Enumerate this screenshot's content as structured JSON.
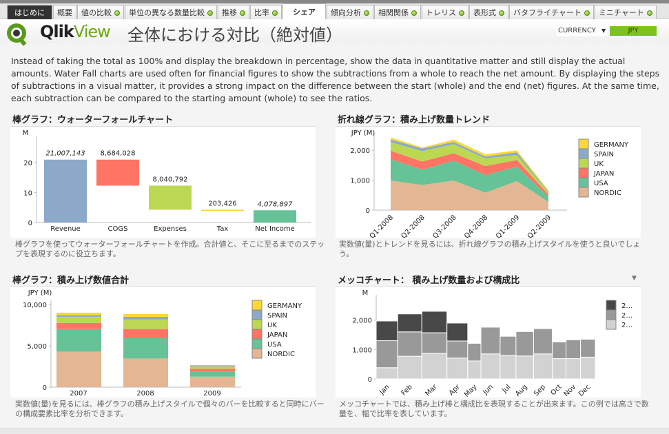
{
  "tabs": [
    {
      "label": "はじめに",
      "dot": false
    },
    {
      "label": "概要",
      "dot": false
    },
    {
      "label": "値の比較",
      "dot": true
    },
    {
      "label": "単位の異なる数量比較",
      "dot": true
    },
    {
      "label": "推移",
      "dot": true
    },
    {
      "label": "比率",
      "dot": true
    },
    {
      "label": "シェア",
      "dot": false,
      "active": true
    },
    {
      "label": "傾向分析",
      "dot": true
    },
    {
      "label": "相関関係",
      "dot": true
    },
    {
      "label": "トレリス",
      "dot": true
    },
    {
      "label": "表形式",
      "dot": true
    },
    {
      "label": "バタフライチャート",
      "dot": true
    },
    {
      "label": "ミニチャート",
      "dot": true
    }
  ],
  "header": {
    "brand_a": "Qlik",
    "brand_b": "View",
    "title": "全体における対比（絶対値）",
    "currency_label": "CURRENCY",
    "currency_value": "JPY"
  },
  "description": "Instead of taking the total as 100% and display the breakdown in percentage, show the data in quantitative matter and still display the actual amounts. Water Fall charts are used often for financial figures to show the subtractions from a whole to reach the net amount. By displaying the steps of subtractions in a visual matter, it provides a strong impact on the difference between the start (whole) and the end (net) figures. At the same time, each subtraction can be compared to the starting amount (whole) to see the ratios.",
  "panels": {
    "waterfall": {
      "title": "棒グラフ：ウォーターフォールチャート",
      "caption": "棒グラフを使ってウォーターフォールチャートを作成。合計値と、そこに至るまでのステップを表現するのに役立ちます。"
    },
    "area": {
      "title": "折れ線グラフ：積み上げ数量トレンド",
      "caption": "実数値(量)とトレンドを見るには、折れ線グラフの積み上げスタイルを使うと良いでしょう。"
    },
    "stacked": {
      "title": "棒グラフ：積み上げ数値合計",
      "caption": "実数値(量)を見るには、棒グラフの積み上げスタイルで個々のバーを比較すると同時にバーの構成要素比率を分析できます。"
    },
    "mekko": {
      "title": "メッコチャート： 積み上げ数量および構成比",
      "caption": "メッコチャートでは、積み上げ棒と構成比を表現することが出来ます。この例では高さで数量を、幅で比率を表しています。"
    }
  },
  "colors": {
    "GERMANY": "#fdd835",
    "SPAIN": "#8ca9c9",
    "UK": "#bcd853",
    "JAPAN": "#ff7465",
    "USA": "#66c297",
    "NORDIC": "#e3b694",
    "accent": "#7dc31d"
  },
  "chart_data": [
    {
      "type": "bar",
      "subtype": "waterfall",
      "ylabel": "M",
      "categories": [
        "Revenue",
        "COGS",
        "Expenses",
        "Tax",
        "Net Income"
      ],
      "values": [
        21007143,
        8684028,
        8040792,
        203426,
        4078897
      ],
      "labels": [
        "21,007,143",
        "8,684,028",
        "8,040,792",
        "203,426",
        "4,078,897"
      ],
      "colors": [
        "#8ca9c9",
        "#ff7465",
        "#bcd853",
        "#fdd835",
        "#66c297"
      ],
      "ylim": [
        0,
        29
      ],
      "yticks": [
        "0",
        "10",
        "20"
      ]
    },
    {
      "type": "area",
      "stacked": true,
      "ylabel": "JPY (M)",
      "categories": [
        "Q1-2008",
        "Q2-2008",
        "Q3-2008",
        "Q4-2008",
        "Q1-2009",
        "Q2-2009"
      ],
      "ylim": [
        0,
        2600
      ],
      "yticks": [
        "0",
        "1,000",
        "2,000"
      ],
      "legend": "right",
      "series": [
        {
          "name": "NORDIC",
          "values": [
            990,
            840,
            990,
            580,
            970,
            270
          ]
        },
        {
          "name": "USA",
          "values": [
            710,
            515,
            665,
            590,
            485,
            175
          ]
        },
        {
          "name": "JAPAN",
          "values": [
            280,
            270,
            245,
            300,
            220,
            75
          ]
        },
        {
          "name": "UK",
          "values": [
            290,
            345,
            300,
            255,
            165,
            70
          ]
        },
        {
          "name": "SPAIN",
          "values": [
            90,
            90,
            75,
            65,
            90,
            30
          ]
        },
        {
          "name": "GERMANY",
          "values": [
            70,
            30,
            80,
            75,
            65,
            35
          ]
        }
      ]
    },
    {
      "type": "bar",
      "stacked": true,
      "ylabel": "JPY (M)",
      "categories": [
        "2007",
        "2008",
        "2009"
      ],
      "ylim": [
        0,
        10000
      ],
      "yticks": [
        "0",
        "5,000",
        "10,000"
      ],
      "legend": "right",
      "series": [
        {
          "name": "NORDIC",
          "values": [
            4300,
            3470,
            1270
          ]
        },
        {
          "name": "USA",
          "values": [
            2725,
            2450,
            630
          ]
        },
        {
          "name": "JAPAN",
          "values": [
            745,
            1105,
            330
          ]
        },
        {
          "name": "UK",
          "values": [
            740,
            1155,
            280
          ]
        },
        {
          "name": "SPAIN",
          "values": [
            220,
            330,
            110
          ]
        },
        {
          "name": "GERMANY",
          "values": [
            280,
            330,
            50
          ]
        }
      ]
    },
    {
      "type": "bar",
      "subtype": "mekko",
      "ylabel": "M",
      "categories": [
        "Jan",
        "Feb",
        "Mar",
        "Apr",
        "May",
        "Jun",
        "Jul",
        "Aug",
        "Sep",
        "Oct",
        "Nov",
        "Dec"
      ],
      "ylim": [
        0,
        2600
      ],
      "yticks": [
        "0",
        "1,000",
        "2,000"
      ],
      "legend": "right",
      "legend_labels": [
        "2…",
        "2…",
        "2…"
      ],
      "colors": [
        "#d2d2d2",
        "#999999",
        "#484848"
      ],
      "series": [
        {
          "values": [
            380,
            770,
            870,
            710,
            610,
            850,
            800,
            780,
            850,
            690,
            690,
            740
          ]
        },
        {
          "values": [
            920,
            830,
            700,
            580,
            600,
            910,
            650,
            830,
            860,
            570,
            640,
            610
          ]
        },
        {
          "values": [
            670,
            610,
            730,
            610,
            0,
            0,
            0,
            0,
            0,
            0,
            0,
            0
          ]
        }
      ]
    }
  ]
}
